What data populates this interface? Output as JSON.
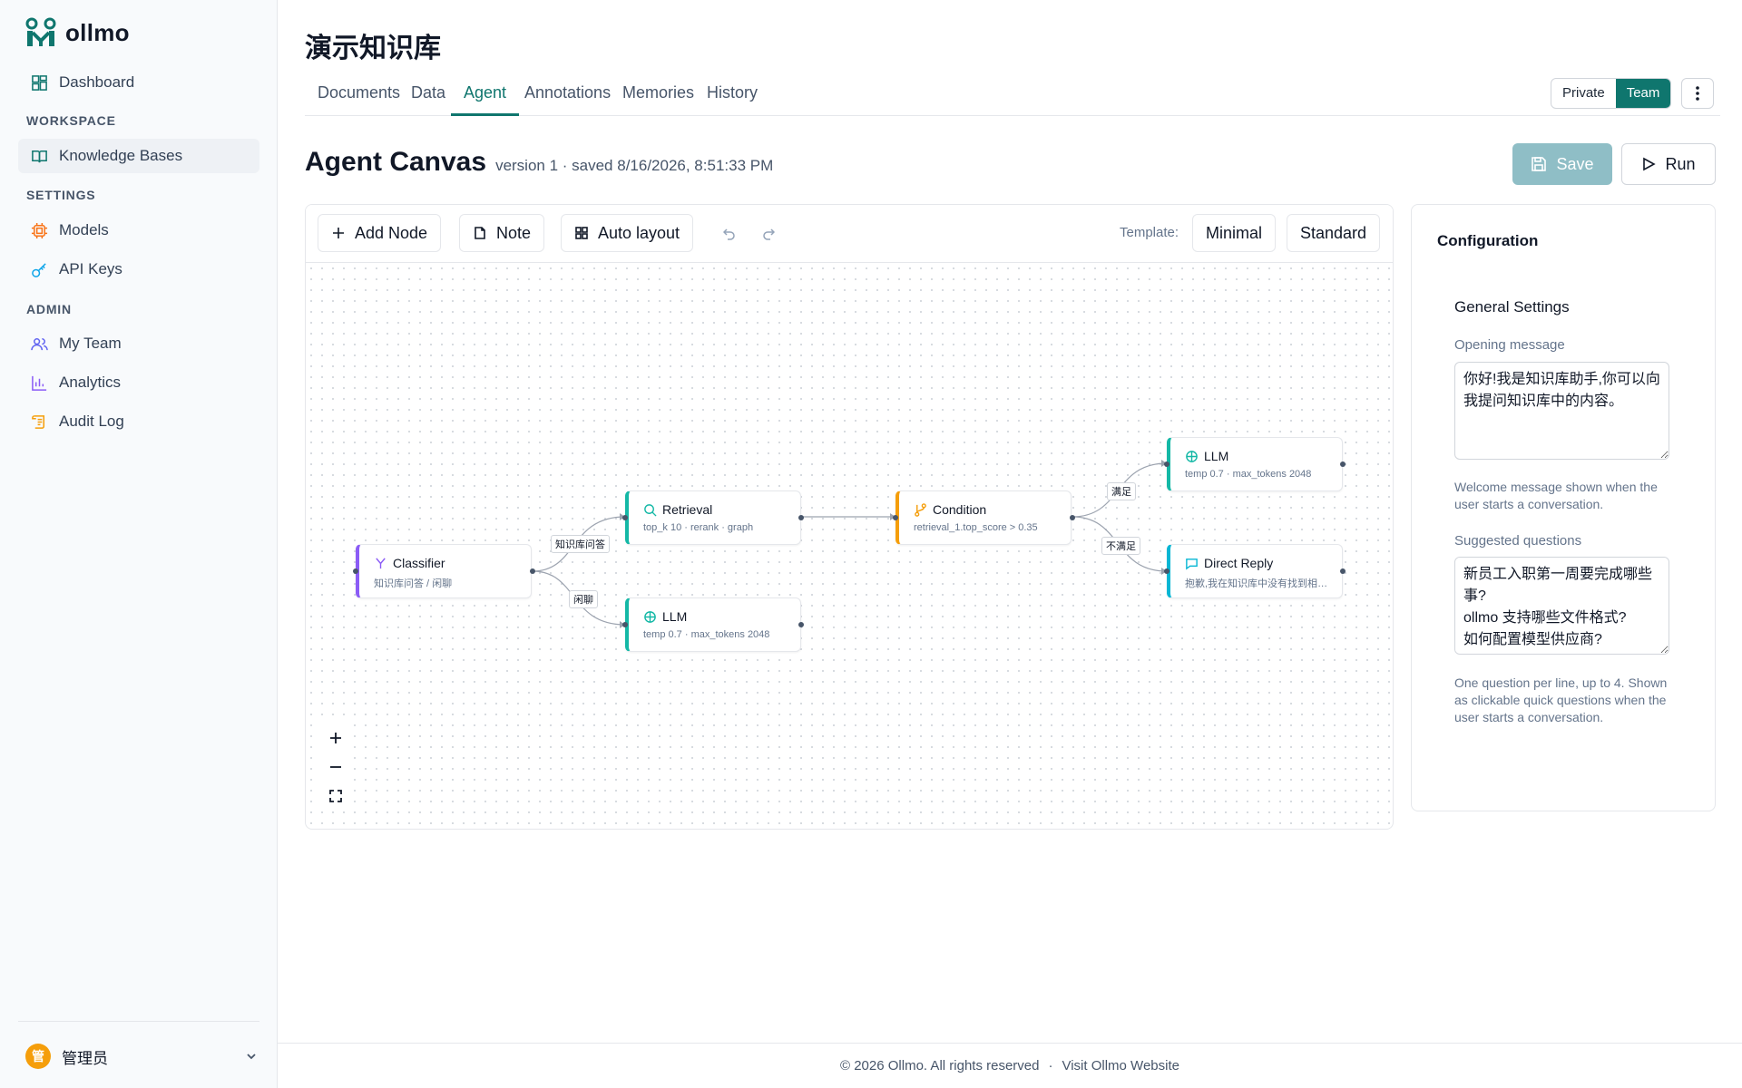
{
  "app": {
    "logo_text": "ollmo"
  },
  "sidebar": {
    "dashboard": "Dashboard",
    "section_workspace": "WORKSPACE",
    "knowledge_bases": "Knowledge Bases",
    "section_settings": "SETTINGS",
    "models": "Models",
    "api_keys": "API Keys",
    "section_admin": "ADMIN",
    "my_team": "My Team",
    "analytics": "Analytics",
    "audit_log": "Audit Log",
    "user": {
      "avatar": "管",
      "name": "管理员"
    }
  },
  "kb": {
    "title": "演示知识库"
  },
  "tabs": [
    "Documents",
    "Data",
    "Agent",
    "Annotations",
    "Memories",
    "History"
  ],
  "visibility": {
    "private": "Private",
    "team": "Team",
    "selected": "Team"
  },
  "canvas": {
    "title": "Agent Canvas",
    "meta": "version 1 · saved 8/16/2026, 8:51:33 PM",
    "save_label": "Save",
    "run_label": "Run",
    "toolbar": {
      "add_node": "Add Node",
      "note": "Note",
      "auto_layout": "Auto layout",
      "template_label": "Template:",
      "minimal": "Minimal",
      "standard": "Standard"
    },
    "nodes": {
      "classifier": {
        "title": "Classifier",
        "sub": "知识库问答 / 闲聊",
        "color": "#8b5cf6"
      },
      "retrieval": {
        "title": "Retrieval",
        "sub": "top_k 10 · rerank · graph",
        "color": "#14b8a6"
      },
      "llm_chat": {
        "title": "LLM",
        "sub": "temp 0.7 · max_tokens 2048",
        "color": "#14b8a6"
      },
      "condition": {
        "title": "Condition",
        "sub": "retrieval_1.top_score > 0.35",
        "color": "#f59e0b"
      },
      "llm_answer": {
        "title": "LLM",
        "sub": "temp 0.7 · max_tokens 2048",
        "color": "#14b8a6"
      },
      "direct_reply": {
        "title": "Direct Reply",
        "sub": "抱歉,我在知识库中没有找到相关信息。",
        "color": "#06b6d4"
      }
    },
    "edge_labels": {
      "kb_qa": "知识库问答",
      "chat": "闲聊",
      "satisfied": "满足",
      "not_satisfied": "不满足"
    }
  },
  "config": {
    "title": "Configuration",
    "section": "General Settings",
    "opening_label": "Opening message",
    "opening_value": "你好!我是知识库助手,你可以向我提问知识库中的内容。",
    "opening_help": "Welcome message shown when the user starts a conversation.",
    "suggested_label": "Suggested questions",
    "suggested_value": "新员工入职第一周要完成哪些事?\nollmo 支持哪些文件格式?\n如何配置模型供应商?",
    "suggested_help": "One question per line, up to 4. Shown as clickable quick questions when the user starts a conversation."
  },
  "footer": {
    "copyright": "© 2026 Ollmo. All rights reserved",
    "sep": "·",
    "link": "Visit Ollmo Website"
  },
  "colors": {
    "brand": "#0f766e",
    "accent_orange": "#f59e0b",
    "purple": "#8b5cf6"
  }
}
